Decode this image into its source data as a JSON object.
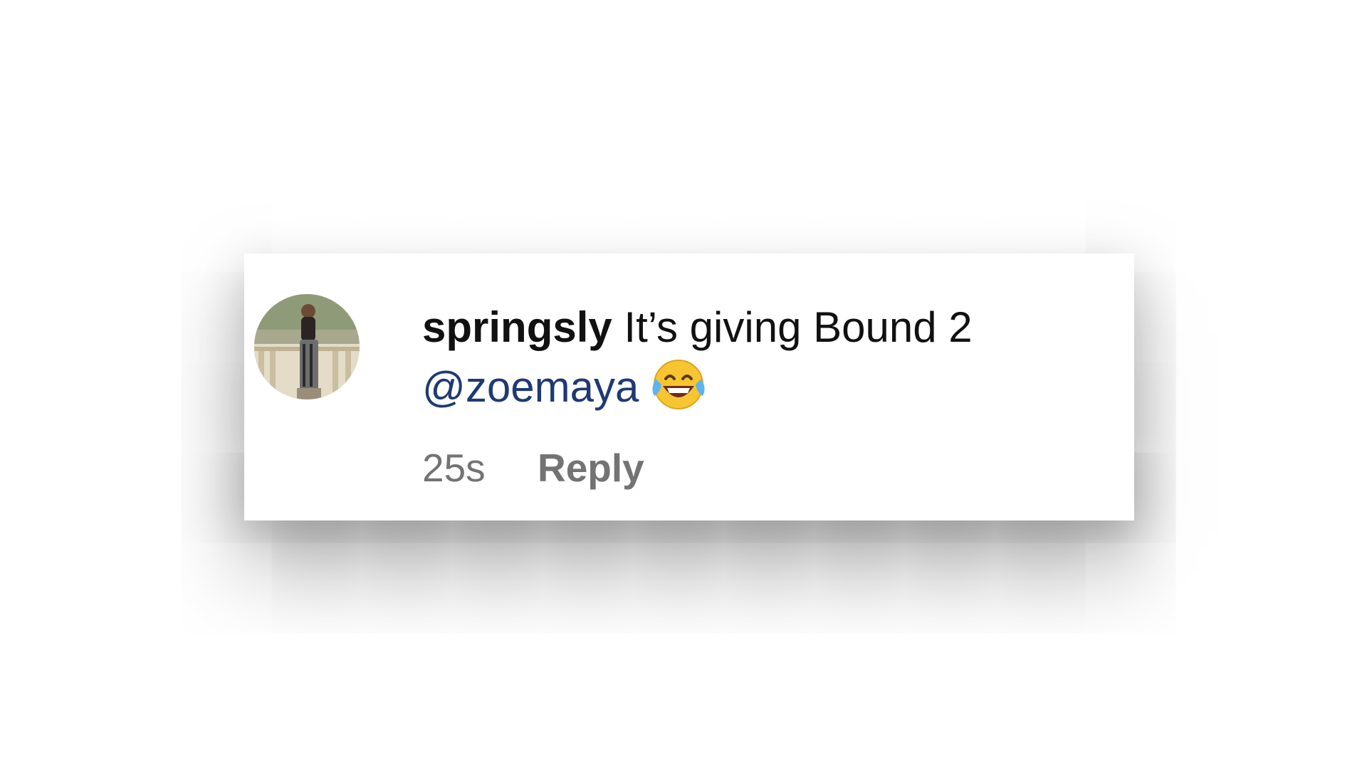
{
  "comment": {
    "avatar": {
      "icon": "profile-photo",
      "alt_description": "user profile photo"
    },
    "username": "springsly",
    "text": "It’s giving Bound 2",
    "mention": "@zoemaya",
    "emoji": "face-with-tears-of-joy-icon",
    "timestamp": "25s",
    "reply_label": "Reply"
  },
  "colors": {
    "mention": "#1f3a72",
    "meta": "#737373",
    "text": "#111111"
  }
}
